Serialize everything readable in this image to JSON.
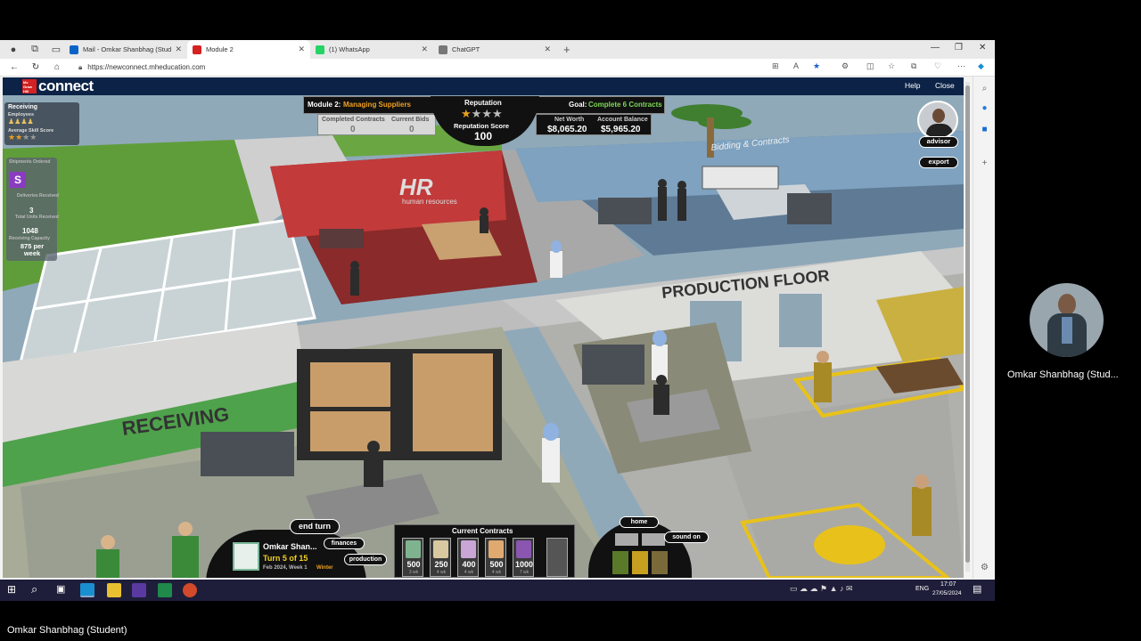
{
  "browser": {
    "tabs": [
      {
        "label": "Mail - Omkar Shanbhag (Studen",
        "active": false,
        "favicon_color": "#0a64c8"
      },
      {
        "label": "Module 2",
        "active": true,
        "favicon_color": "#d42121"
      },
      {
        "label": "(1) WhatsApp",
        "active": false,
        "favicon_color": "#25d366"
      },
      {
        "label": "ChatGPT",
        "active": false,
        "favicon_color": "#777777"
      }
    ],
    "url": "https://newconnect.mheducation.com"
  },
  "connect": {
    "logo_box": "Mc Graw Hill",
    "logo": "connect",
    "help": "Help",
    "close": "Close"
  },
  "hud": {
    "module_prefix": "Module 2:",
    "module_name": "Managing Suppliers",
    "reputation_label": "Reputation",
    "reputation_stars": 1,
    "reputation_stars_total": 4,
    "reputation_score_label": "Reputation Score",
    "reputation_score": "100",
    "goal_prefix": "Goal:",
    "goal": "Complete 6 Contracts",
    "completed_label": "Completed Contracts",
    "completed_value": "0",
    "bids_label": "Current Bids",
    "bids_value": "0",
    "networth_label": "Net Worth",
    "networth_value": "$8,065.20",
    "balance_label": "Account Balance",
    "balance_value": "$5,965.20",
    "advisor": "advisor",
    "export": "export"
  },
  "receiving_panel": {
    "title": "Receiving",
    "employees_label": "Employees",
    "employees_count": 4,
    "skill_label": "Average Skill Score",
    "skill_stars": 2,
    "skill_stars_total": 4,
    "supplier_label": "Shipments Ordered",
    "supplier_badge": "S",
    "deliveries_label": "Deliveries Received",
    "deliveries_value": "3",
    "units_label": "Total Units Received",
    "units_value": "1048",
    "capacity_label": "Receiving Capacity",
    "capacity_value": "875 per week"
  },
  "scene": {
    "hr_title": "HR",
    "hr_sub": "human resources",
    "bidding": "Bidding & Contracts",
    "production": "PRODUCTION FLOOR",
    "receiving": "RECEIVING"
  },
  "bottom": {
    "end_turn": "end turn",
    "finances": "finances",
    "production": "production",
    "player_name": "Omkar Shan...",
    "turn": "Turn 5 of 15",
    "date": "Feb 2024, Week 1",
    "season": "Winter",
    "contracts_title": "Current Contracts",
    "contracts": [
      {
        "qty": "500",
        "weeks": "3 wk",
        "color": "#7fb38f"
      },
      {
        "qty": "250",
        "weeks": "4 wk",
        "color": "#d8c9a0"
      },
      {
        "qty": "400",
        "weeks": "4 wk",
        "color": "#c9a6d6"
      },
      {
        "qty": "500",
        "weeks": "4 wk",
        "color": "#e0a96f"
      },
      {
        "qty": "1000",
        "weeks": "7 wk",
        "color": "#8a56b0"
      }
    ],
    "home": "home",
    "sound": "sound on"
  },
  "taskbar": {
    "lang": "ENG",
    "time": "17:07",
    "date": "27/05/2024"
  },
  "meeting": {
    "participant_name": "Omkar Shanbhag (Stud...",
    "self_name": "Omkar Shanbhag (Student)"
  }
}
